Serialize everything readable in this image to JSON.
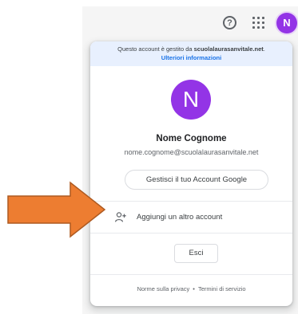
{
  "topbar": {
    "help_icon": "help-circle-icon",
    "apps_icon": "apps-grid-icon",
    "avatar_letter": "N"
  },
  "card": {
    "notice_prefix": "Questo account è gestito da ",
    "notice_domain": "scuolalaurasanvitale.net",
    "notice_suffix": ".",
    "notice_link": "Ulteriori informazioni",
    "avatar_letter": "N",
    "name": "Nome Cognome",
    "email": "nome.cognome@scuolalaurasanvitale.net",
    "manage_label": "Gestisci il tuo Account Google",
    "add_account_icon": "person-add-icon",
    "add_account_label": "Aggiungi un altro account",
    "logout_label": "Esci",
    "privacy_label": "Norme sulla privacy",
    "separator": "•",
    "terms_label": "Termini di servizio"
  },
  "colors": {
    "avatar": "#9334e6",
    "notice_bg": "#e8f0fe",
    "link": "#1a73e8",
    "arrow": "#ed7d31",
    "arrow_stroke": "#ae5a21"
  }
}
